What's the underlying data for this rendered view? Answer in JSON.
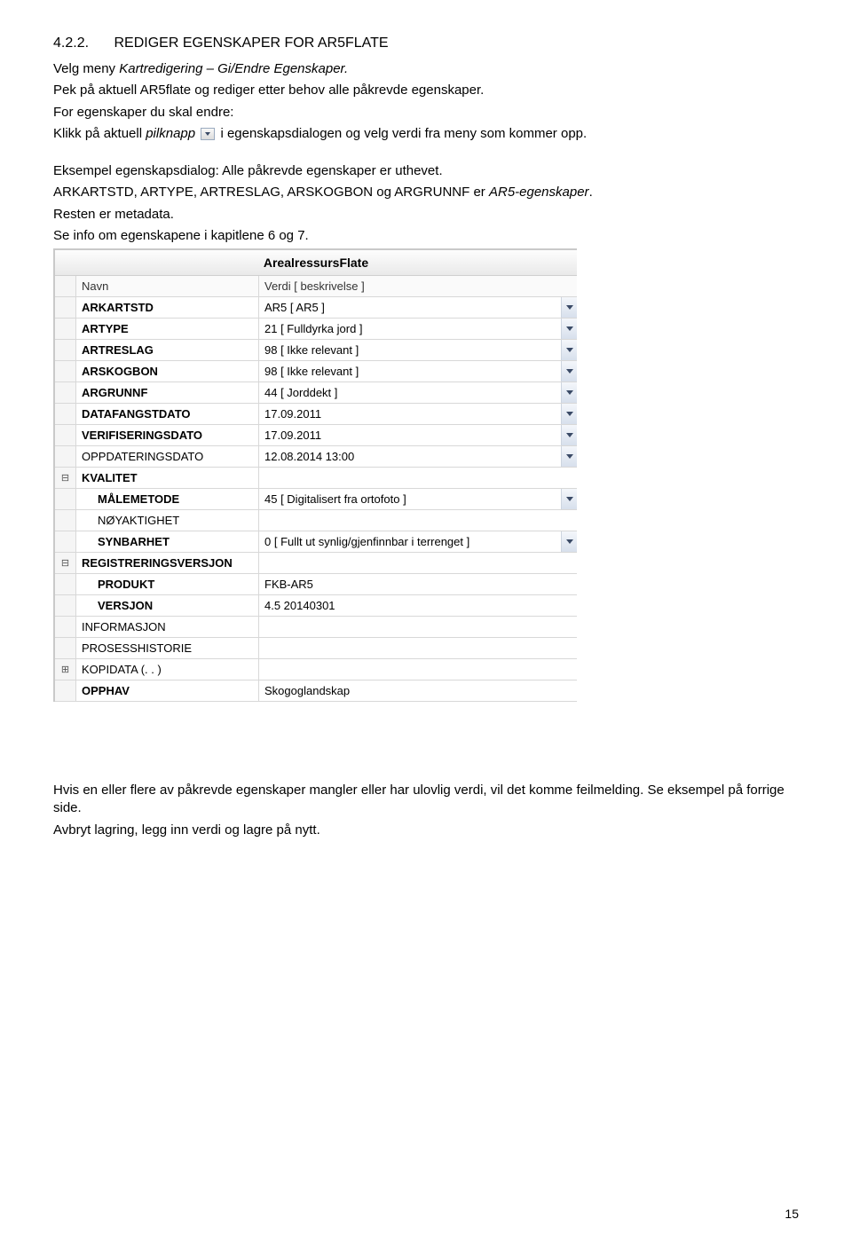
{
  "heading": {
    "num": "4.2.2.",
    "title": "REDIGER EGENSKAPER FOR AR5FLATE"
  },
  "para1_a": "Velg meny ",
  "para1_b": "Kartredigering – Gi/Endre Egenskaper.",
  "para2": "Pek på aktuell AR5flate og rediger etter behov alle påkrevde egenskaper.",
  "para3": "For egenskaper du skal endre:",
  "para4_a": "Klikk på aktuell ",
  "para4_b": "pilknapp",
  "para4_c": "  i egenskapsdialogen og velg verdi fra meny som kommer opp.",
  "para5": "Eksempel egenskapsdialog: Alle påkrevde egenskaper er uthevet.",
  "para6_a": "ARKARTSTD, ARTYPE, ARTRESLAG, ARSKOGBON og ARGRUNNF er ",
  "para6_b": "AR5-egenskaper",
  "para6_c": ".",
  "para7": "Resten er metadata.",
  "para8": "Se info om egenskapene i kapitlene 6 og 7.",
  "dialog": {
    "title": "ArealressursFlate",
    "header_name": "Navn",
    "header_value": "Verdi [ beskrivelse ]",
    "rows": [
      {
        "tree": "",
        "name": "ARKARTSTD",
        "bold": true,
        "indent": false,
        "value": "AR5 [ AR5 ]",
        "dd": true
      },
      {
        "tree": "",
        "name": "ARTYPE",
        "bold": true,
        "indent": false,
        "value": "21 [ Fulldyrka jord ]",
        "dd": true
      },
      {
        "tree": "",
        "name": "ARTRESLAG",
        "bold": true,
        "indent": false,
        "value": "98 [ Ikke relevant ]",
        "dd": true
      },
      {
        "tree": "",
        "name": "ARSKOGBON",
        "bold": true,
        "indent": false,
        "value": "98 [ Ikke relevant ]",
        "dd": true
      },
      {
        "tree": "",
        "name": "ARGRUNNF",
        "bold": true,
        "indent": false,
        "value": "44 [ Jorddekt ]",
        "dd": true
      },
      {
        "tree": "",
        "name": "DATAFANGSTDATO",
        "bold": true,
        "indent": false,
        "value": "17.09.2011",
        "dd": true
      },
      {
        "tree": "",
        "name": "VERIFISERINGSDATO",
        "bold": true,
        "indent": false,
        "value": "17.09.2011",
        "dd": true
      },
      {
        "tree": "",
        "name": "OPPDATERINGSDATO",
        "bold": false,
        "indent": false,
        "value": "12.08.2014 13:00",
        "dd": true
      },
      {
        "tree": "⊟",
        "name": "KVALITET",
        "bold": true,
        "indent": false,
        "value": "",
        "dd": false
      },
      {
        "tree": "",
        "name": "MÅLEMETODE",
        "bold": true,
        "indent": true,
        "value": "45 [ Digitalisert fra ortofoto ]",
        "dd": true
      },
      {
        "tree": "",
        "name": "NØYAKTIGHET",
        "bold": false,
        "indent": true,
        "value": "",
        "dd": false
      },
      {
        "tree": "",
        "name": "SYNBARHET",
        "bold": true,
        "indent": true,
        "value": "0 [ Fullt ut synlig/gjenfinnbar i terrenget ]",
        "dd": true
      },
      {
        "tree": "⊟",
        "name": "REGISTRERINGSVERSJON",
        "bold": true,
        "indent": false,
        "value": "",
        "dd": false
      },
      {
        "tree": "",
        "name": "PRODUKT",
        "bold": true,
        "indent": true,
        "value": "FKB-AR5",
        "dd": false
      },
      {
        "tree": "",
        "name": "VERSJON",
        "bold": true,
        "indent": true,
        "value": "4.5 20140301",
        "dd": false
      },
      {
        "tree": "",
        "name": "INFORMASJON",
        "bold": false,
        "indent": false,
        "value": "",
        "dd": false
      },
      {
        "tree": "",
        "name": "PROSESSHISTORIE",
        "bold": false,
        "indent": false,
        "value": "",
        "dd": false
      },
      {
        "tree": "⊞",
        "name": "KOPIDATA (. . )",
        "bold": false,
        "indent": false,
        "value": "",
        "dd": false
      },
      {
        "tree": "",
        "name": "OPPHAV",
        "bold": true,
        "indent": false,
        "value": "Skogoglandskap",
        "dd": false
      }
    ]
  },
  "bottom1": "Hvis en eller flere av påkrevde egenskaper mangler eller har ulovlig verdi, vil det komme feilmelding. Se eksempel på forrige side.",
  "bottom2": "Avbryt lagring, legg inn verdi og lagre på nytt.",
  "page_number": "15"
}
